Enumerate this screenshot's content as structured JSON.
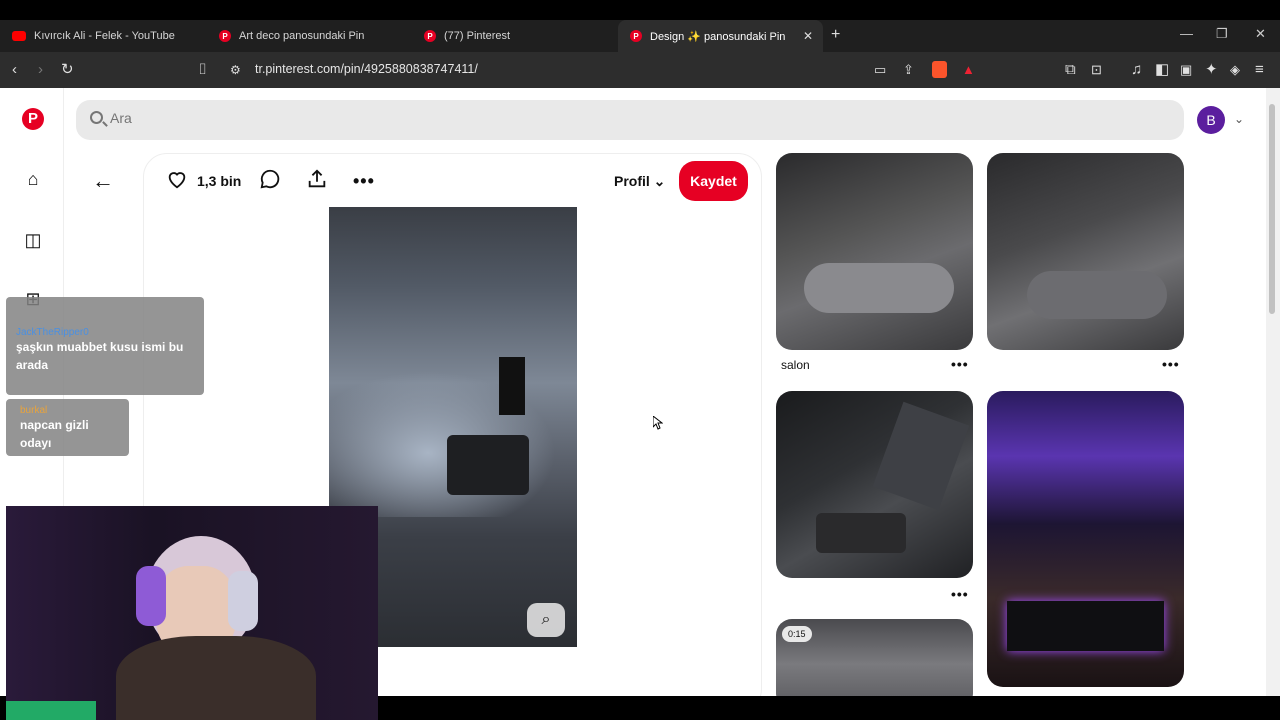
{
  "browser": {
    "tabs": [
      {
        "title": "Kıvırcık Ali - Felek - YouTube",
        "icon": "youtube-icon"
      },
      {
        "title": "Art deco panosundaki Pin",
        "icon": "pinterest-icon"
      },
      {
        "title": "(77) Pinterest",
        "icon": "pinterest-icon"
      },
      {
        "title": "Design ✨ panosundaki Pin",
        "icon": "pinterest-icon",
        "active": true
      }
    ],
    "url": "tr.pinterest.com/pin/4925880838747411/"
  },
  "search": {
    "placeholder": "Ara"
  },
  "user": {
    "avatar_letter": "B"
  },
  "pin": {
    "likes": "1,3 bin",
    "profile_label": "Profil",
    "save_label": "Kaydet"
  },
  "grid": {
    "first_title": "salon",
    "video_duration": "0:15"
  },
  "chat": [
    {
      "user": "JackTheRipper0",
      "message": "şaşkın muabbet kusu ismi bu arada",
      "user_color": "#4a90e2"
    },
    {
      "user": "burkal",
      "message": "napcan gizli odayı",
      "user_color": "#e8a33c"
    }
  ],
  "colors": {
    "accent": "#e60023",
    "avatar": "#5b1e9e"
  }
}
